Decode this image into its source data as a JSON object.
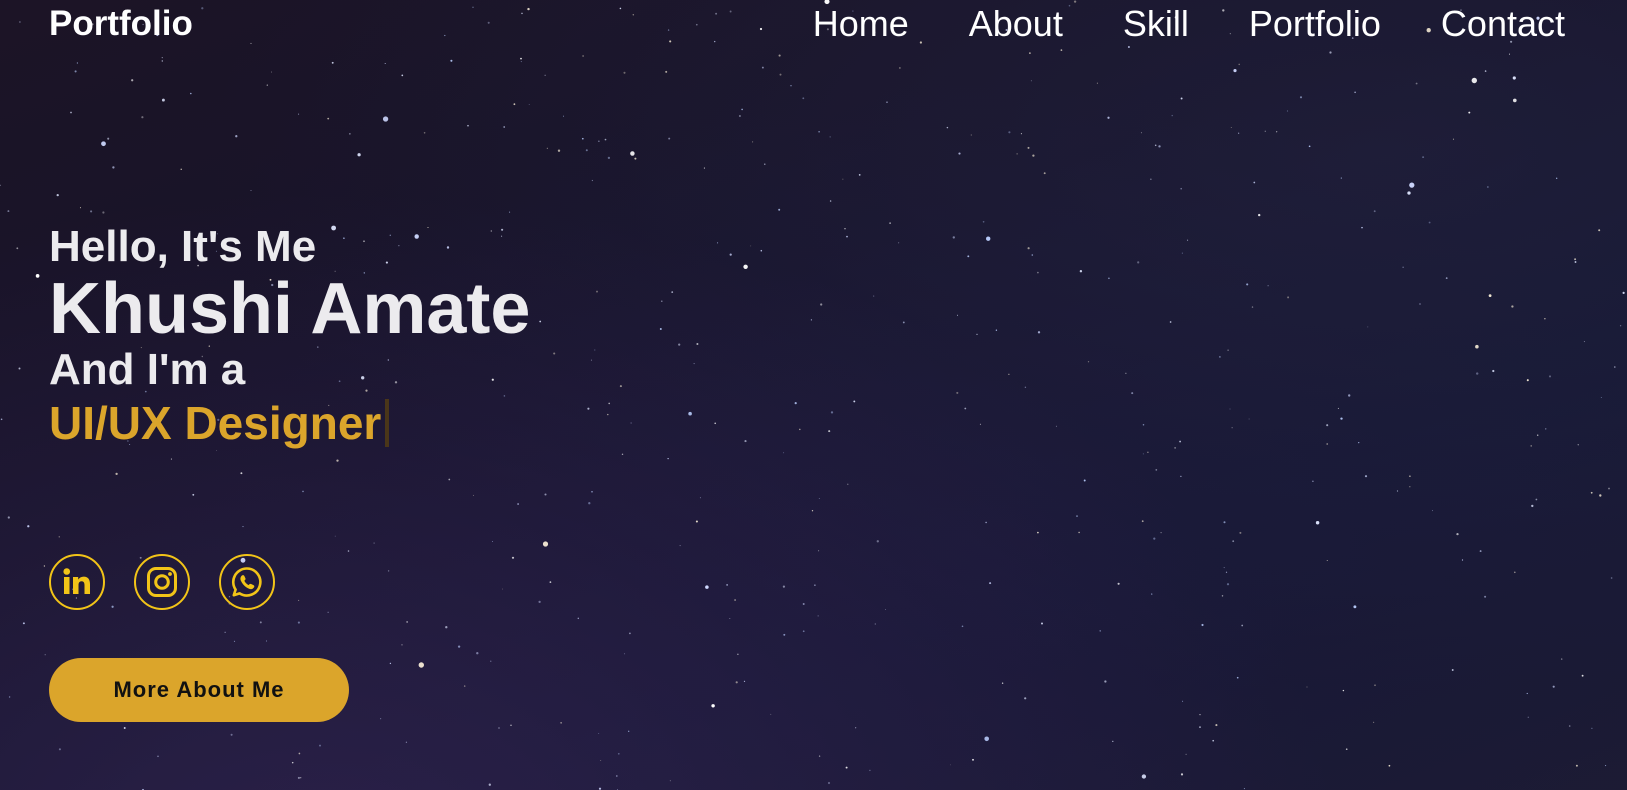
{
  "header": {
    "logo": "Portfolio",
    "nav": [
      {
        "label": "Home"
      },
      {
        "label": "About"
      },
      {
        "label": "Skill"
      },
      {
        "label": "Portfolio"
      },
      {
        "label": "Contact"
      }
    ]
  },
  "hero": {
    "greeting": "Hello, It's Me",
    "name": "Khushi Amate",
    "intro": "And I'm a",
    "role": "UI/UX Designer"
  },
  "socials": [
    {
      "icon": "linkedin-icon"
    },
    {
      "icon": "instagram-icon"
    },
    {
      "icon": "whatsapp-icon"
    }
  ],
  "cta": {
    "label": "More About Me"
  },
  "colors": {
    "accent": "#dba52b",
    "icon_ring": "#f2c418",
    "text": "#ecebee",
    "background": "#16132a"
  }
}
